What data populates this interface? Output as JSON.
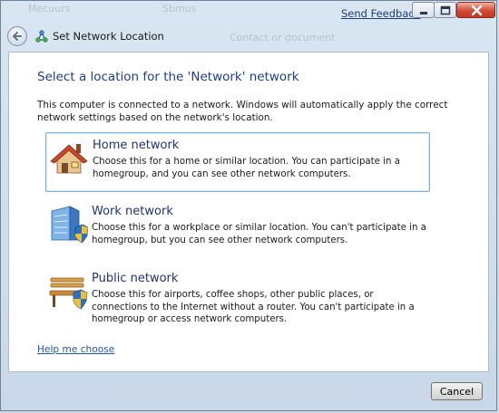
{
  "background": {
    "ghost_texts": [
      "Mecuurs",
      "Sbmus",
      "Contact or document"
    ]
  },
  "titlebar": {
    "feedback_label": "Send Feedback",
    "title": "Set Network Location"
  },
  "content": {
    "heading": "Select a location for the 'Network' network",
    "intro": "This computer is connected to a network. Windows will automatically apply the correct network settings based on the network's location.",
    "options": [
      {
        "title": "Home network",
        "description": "Choose this for a home or similar location. You can participate in a homegroup, and you can see other network computers.",
        "icon": "house-icon",
        "selected": true
      },
      {
        "title": "Work network",
        "description": "Choose this for a workplace or similar location. You can't participate in a homegroup, but you can see other network computers.",
        "icon": "office-building-shield-icon",
        "selected": false
      },
      {
        "title": "Public network",
        "description": "Choose this for airports, coffee shops, other public places, or connections to the Internet without a router. You can't participate in a homegroup or access network computers.",
        "icon": "park-bench-shield-icon",
        "selected": false
      }
    ],
    "help_link": "Help me choose"
  },
  "footer": {
    "cancel_label": "Cancel"
  },
  "colors": {
    "heading": "#1b3e8f",
    "option_title": "#1f3276",
    "link": "#1f57b8",
    "selection_border": "#7fb1d6"
  }
}
